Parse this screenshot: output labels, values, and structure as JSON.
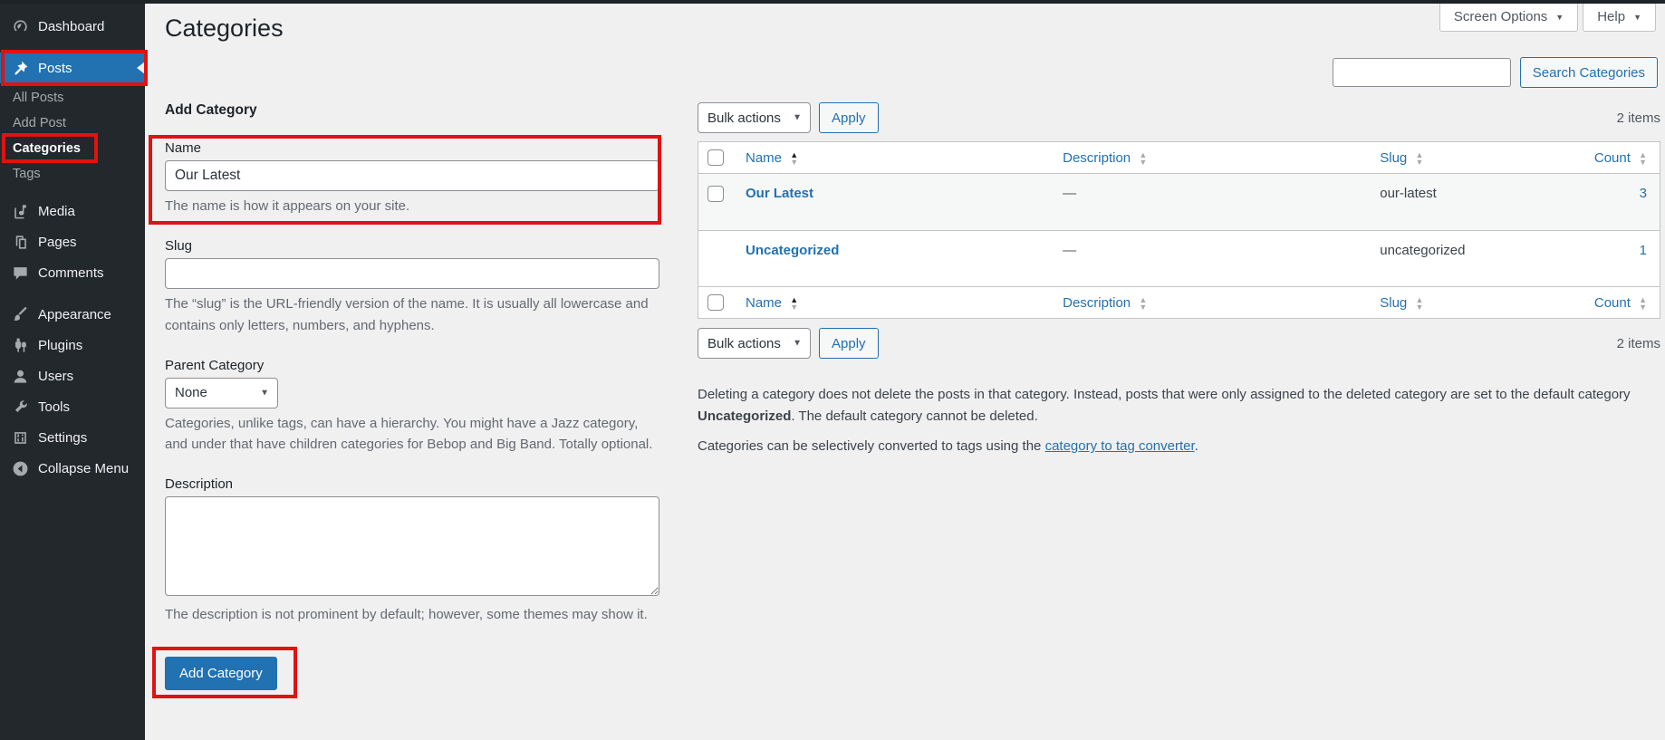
{
  "page": {
    "title": "Categories"
  },
  "topbar": {
    "screen_options": "Screen Options",
    "help": "Help"
  },
  "icons": {
    "select_chevron": "▼",
    "tab_chevron": "▼",
    "sort_up": "▲",
    "sort_down": "▼"
  },
  "colors": {
    "accent": "#2271b1",
    "annotation_red": "#e01212",
    "sidebar_bg": "#23282d",
    "content_bg": "#f0f0f1"
  },
  "sidebar": {
    "items": [
      {
        "label": "Dashboard"
      },
      {
        "label": "Posts"
      },
      {
        "label": "Media"
      },
      {
        "label": "Pages"
      },
      {
        "label": "Comments"
      },
      {
        "label": "Appearance"
      },
      {
        "label": "Plugins"
      },
      {
        "label": "Users"
      },
      {
        "label": "Tools"
      },
      {
        "label": "Settings"
      },
      {
        "label": "Collapse Menu"
      }
    ],
    "posts_submenu": [
      {
        "label": "All Posts"
      },
      {
        "label": "Add Post"
      },
      {
        "label": "Categories"
      },
      {
        "label": "Tags"
      }
    ]
  },
  "search": {
    "value": "",
    "button": "Search Categories"
  },
  "form": {
    "heading": "Add Category",
    "name": {
      "label": "Name",
      "value": "Our Latest",
      "help": "The name is how it appears on your site."
    },
    "slug": {
      "label": "Slug",
      "value": "",
      "help": "The “slug” is the URL-friendly version of the name. It is usually all lowercase and contains only letters, numbers, and hyphens."
    },
    "parent": {
      "label": "Parent Category",
      "value": "None",
      "help": "Categories, unlike tags, can have a hierarchy. You might have a Jazz category, and under that have children categories for Bebop and Big Band. Totally optional."
    },
    "description": {
      "label": "Description",
      "value": "",
      "help": "The description is not prominent by default; however, some themes may show it."
    },
    "submit": "Add Category"
  },
  "list": {
    "bulk_actions": "Bulk actions",
    "apply": "Apply",
    "items_count": "2 items",
    "columns": {
      "name": "Name",
      "description": "Description",
      "slug": "Slug",
      "count": "Count"
    },
    "rows": [
      {
        "name": "Our Latest",
        "description": "—",
        "slug": "our-latest",
        "count": "3"
      },
      {
        "name": "Uncategorized",
        "description": "—",
        "slug": "uncategorized",
        "count": "1"
      }
    ],
    "footnote_1a": "Deleting a category does not delete the posts in that category. Instead, posts that were only assigned to the deleted category are set to the default category ",
    "footnote_1b": "Uncategorized",
    "footnote_1c": ". The default category cannot be deleted.",
    "footnote_2a": "Categories can be selectively converted to tags using the ",
    "footnote_2_link": "category to tag converter",
    "footnote_2c": "."
  }
}
